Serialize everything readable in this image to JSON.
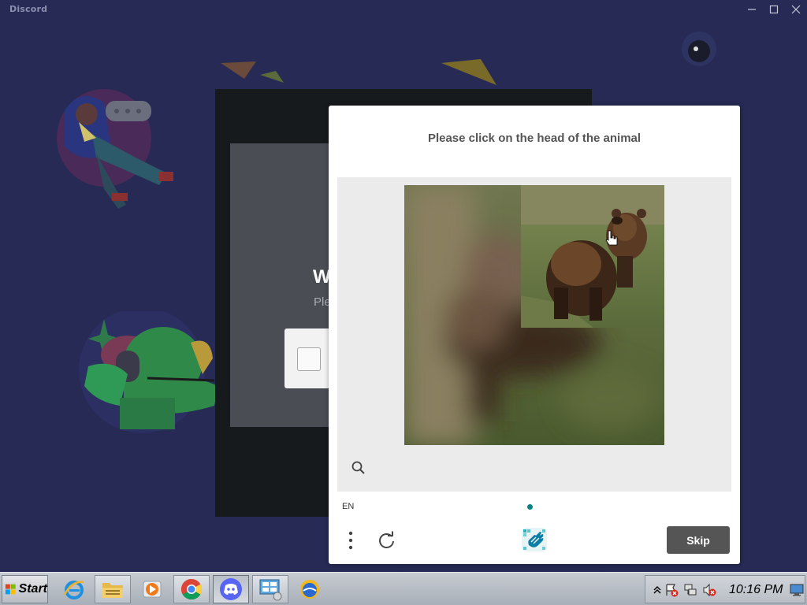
{
  "window": {
    "title": "Discord",
    "controls": {
      "minimize_icon": "minimize-icon",
      "maximize_icon": "maximize-icon",
      "close_icon": "close-icon"
    }
  },
  "login": {
    "title_partial": "W",
    "subtitle_partial": "Ple"
  },
  "captcha": {
    "prompt": "Please click on the head of the animal",
    "language": "EN",
    "skip_label": "Skip",
    "subject": "bear",
    "accent_color": "#0a8283",
    "icons": {
      "zoom": "zoom-icon",
      "menu": "more-options-icon",
      "refresh": "refresh-icon",
      "logo": "hcaptcha-logo"
    }
  },
  "taskbar": {
    "start_label": "Start",
    "apps": [
      {
        "name": "Internet Explorer",
        "icon": "internet-explorer-icon"
      },
      {
        "name": "File Explorer",
        "icon": "folder-icon"
      },
      {
        "name": "Media Player",
        "icon": "media-player-icon"
      },
      {
        "name": "Google Chrome",
        "icon": "chrome-icon"
      },
      {
        "name": "Discord",
        "icon": "discord-icon",
        "active": true
      },
      {
        "name": "Control Panel",
        "icon": "control-panel-icon"
      },
      {
        "name": "Weather",
        "icon": "sun-globe-icon"
      }
    ],
    "clock": "10:16 PM"
  },
  "colors": {
    "discord_bg": "#262a54",
    "captcha_skip": "#555555",
    "taskbar": "#b9bec6"
  }
}
